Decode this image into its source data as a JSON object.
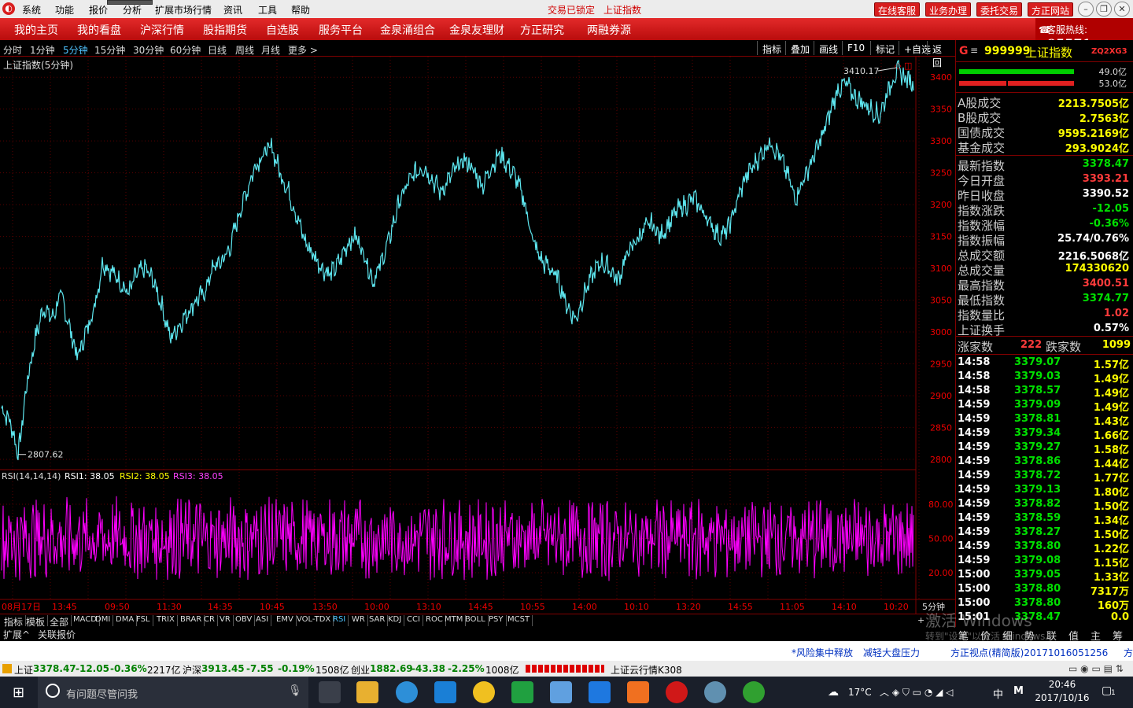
{
  "menu": {
    "items": [
      "系统",
      "功能",
      "报价",
      "分析",
      "扩展市场行情",
      "资讯",
      "工具",
      "帮助"
    ],
    "status_locked": "交易已锁定",
    "status_index": "上证指数",
    "right_buttons": [
      "在线客服",
      "业务办理",
      "委托交易",
      "方正网站"
    ]
  },
  "nav": {
    "items": [
      "我的主页",
      "我的看盘",
      "沪深行情",
      "股指期货",
      "自选股",
      "服务平台",
      "金泉涌组合",
      "金泉友理财",
      "方正研究",
      "两融券源"
    ],
    "hotline_label": "客服热线:",
    "hotline_number": "95571"
  },
  "periods": {
    "items": [
      "分时",
      "1分钟",
      "5分钟",
      "15分钟",
      "30分钟",
      "60分钟",
      "日线",
      "周线",
      "月线",
      "更多 >"
    ],
    "active_index": 2,
    "tools": [
      "指标",
      "叠加",
      "画线",
      "F10",
      "标记",
      "+自选",
      "返回"
    ]
  },
  "chart_data": {
    "type": "line",
    "title": "上证指数(5分钟)",
    "price_axis": [
      3400,
      3350,
      3300,
      3250,
      3200,
      3150,
      3100,
      3050,
      3000,
      2950,
      2900,
      2850,
      2800
    ],
    "ylim": [
      2790,
      3420
    ],
    "high_annotation": "3410.17",
    "low_annotation": "2807.62",
    "x": [
      "08月17日",
      "13:45",
      "09:50",
      "11:30",
      "14:35",
      "10:45",
      "13:50",
      "10:00",
      "13:10",
      "14:45",
      "10:55",
      "14:00",
      "10:10",
      "13:20",
      "14:55",
      "11:05",
      "14:10",
      "10:20"
    ],
    "series": [
      {
        "values": [
          2880,
          2860,
          2808,
          2920,
          2990,
          3040,
          3020,
          3060,
          3010,
          2960,
          3000,
          3040,
          3110,
          3095,
          3080,
          3060,
          3090,
          3100,
          3080,
          3040,
          2990,
          3010,
          3030,
          3050,
          3060,
          3100,
          3110,
          3130,
          3180,
          3220,
          3260,
          3280,
          3290,
          3250,
          3220,
          3180,
          3140,
          3120,
          3100,
          3090,
          3110,
          3140,
          3150,
          3120,
          3080,
          3110,
          3150,
          3200,
          3230,
          3250,
          3260,
          3240,
          3220,
          3240,
          3260,
          3270,
          3250,
          3230,
          3260,
          3280,
          3260,
          3240,
          3200,
          3140,
          3110,
          3100,
          3080,
          3040,
          3020,
          3060,
          3090,
          3110,
          3100,
          3080,
          3120,
          3140,
          3160,
          3170,
          3150,
          3170,
          3190,
          3200,
          3210,
          3190,
          3170,
          3150,
          3160,
          3200,
          3240,
          3260,
          3280,
          3300,
          3280,
          3250,
          3210,
          3240,
          3270,
          3300,
          3340,
          3380,
          3390,
          3370,
          3360,
          3350,
          3340,
          3380,
          3410,
          3400,
          3390
        ]
      }
    ],
    "rsi_title": "RSI(14,14,14)",
    "rsi_labels": [
      "RSI1: 38.05",
      "RSI2: 38.05",
      "RSI3: 38.05"
    ],
    "rsi_axis": [
      "80.00",
      "50.00",
      "20.00"
    ],
    "rsi_ylim": [
      0,
      100
    ]
  },
  "indicators": {
    "left_tabs": [
      "指标",
      "模板",
      "全部"
    ],
    "items": [
      "MACD",
      "DMI",
      "DMA",
      "FSL",
      "TRIX",
      "BRAR",
      "CR",
      "VR",
      "OBV",
      "ASI",
      "EMV",
      "VOL-TDX",
      "RSI",
      "WR",
      "SAR",
      "KDJ",
      "CCI",
      "ROC",
      "MTM",
      "BOLL",
      "PSY",
      "MCST"
    ],
    "active": "RSI",
    "ext": [
      "扩展^",
      "关联报价"
    ],
    "min_period": "5分钟"
  },
  "quote": {
    "code": "999999",
    "name": "上证指数",
    "tag": "ZQ2XG3",
    "bar_up_pct": "49.0亿",
    "bar_dn_pct": "53.0亿",
    "vol_rows": [
      {
        "k": "A股成交",
        "v": "2213.7505亿"
      },
      {
        "k": "B股成交",
        "v": "2.7563亿"
      },
      {
        "k": "国债成交",
        "v": "9595.2169亿"
      },
      {
        "k": "基金成交",
        "v": "293.9024亿"
      }
    ],
    "stat_rows": [
      {
        "k": "最新指数",
        "v": "3378.47",
        "c": "dn"
      },
      {
        "k": "今日开盘",
        "v": "3393.21",
        "c": "up"
      },
      {
        "k": "昨日收盘",
        "v": "3390.52",
        "c": "wt"
      },
      {
        "k": "指数涨跌",
        "v": "-12.05",
        "c": "dn"
      },
      {
        "k": "指数涨幅",
        "v": "-0.36%",
        "c": "dn"
      },
      {
        "k": "指数振幅",
        "v": "25.74/0.76%",
        "c": "wt"
      },
      {
        "k": "总成交额",
        "v": "2216.5068亿",
        "c": "wt"
      },
      {
        "k": "总成交量",
        "v": "174330620",
        "c": "yl"
      },
      {
        "k": "最高指数",
        "v": "3400.51",
        "c": "up"
      },
      {
        "k": "最低指数",
        "v": "3374.77",
        "c": "dn"
      },
      {
        "k": "指数量比",
        "v": "1.02",
        "c": "up"
      },
      {
        "k": "上证换手",
        "v": "0.57%",
        "c": "wt"
      }
    ],
    "adv_label": "涨家数",
    "adv_value": "222",
    "dec_label": "跌家数",
    "dec_value": "1099",
    "ticks": [
      {
        "t": "14:58",
        "p": "3379.07",
        "v": "1.57亿"
      },
      {
        "t": "14:58",
        "p": "3379.03",
        "v": "1.49亿"
      },
      {
        "t": "14:58",
        "p": "3378.57",
        "v": "1.49亿"
      },
      {
        "t": "14:59",
        "p": "3379.09",
        "v": "1.49亿"
      },
      {
        "t": "14:59",
        "p": "3378.81",
        "v": "1.43亿"
      },
      {
        "t": "14:59",
        "p": "3379.34",
        "v": "1.66亿"
      },
      {
        "t": "14:59",
        "p": "3379.27",
        "v": "1.58亿"
      },
      {
        "t": "14:59",
        "p": "3378.86",
        "v": "1.44亿"
      },
      {
        "t": "14:59",
        "p": "3378.72",
        "v": "1.77亿"
      },
      {
        "t": "14:59",
        "p": "3379.13",
        "v": "1.80亿"
      },
      {
        "t": "14:59",
        "p": "3378.82",
        "v": "1.50亿"
      },
      {
        "t": "14:59",
        "p": "3378.59",
        "v": "1.34亿"
      },
      {
        "t": "14:59",
        "p": "3378.27",
        "v": "1.50亿"
      },
      {
        "t": "14:59",
        "p": "3378.80",
        "v": "1.22亿"
      },
      {
        "t": "14:59",
        "p": "3379.08",
        "v": "1.15亿"
      },
      {
        "t": "15:00",
        "p": "3379.05",
        "v": "1.33亿"
      },
      {
        "t": "15:00",
        "p": "3378.80",
        "v": "7317万"
      },
      {
        "t": "15:00",
        "p": "3378.80",
        "v": "160万"
      },
      {
        "t": "15:01",
        "p": "3378.47",
        "v": "0.0"
      }
    ],
    "bottom_tabs": [
      "笔",
      "价",
      "细",
      "势",
      "联",
      "值",
      "主",
      "筹"
    ]
  },
  "news": {
    "items": [
      "*风险集中释放",
      "减轻大盘压力",
      "方正视点(精简版)20171016051256",
      "方"
    ],
    "watermark1": "激活 Windows",
    "watermark2": "转到\"设置\"以激活 Windows。"
  },
  "ticker": {
    "sh_label": "上证",
    "sh_val": "3378.47",
    "sh_chg": "-12.05",
    "sh_pct": "-0.36%",
    "sh_amt": "2217亿",
    "hs_label": "沪深",
    "hs_val": "3913.45",
    "hs_chg": "-7.55",
    "hs_pct": "-0.19%",
    "hs_amt": "1508亿",
    "cy_label": "创业",
    "cy_val": "1882.69",
    "cy_chg": "-43.38",
    "cy_pct": "-2.25%",
    "cy_amt": "1008亿",
    "cloud": "上证云行情K308"
  },
  "taskbar": {
    "search_placeholder": "有问题尽管问我",
    "temp": "17°C",
    "ime": "中",
    "time": "20:46",
    "date": "2017/10/16",
    "notify": "1"
  },
  "colors": {
    "price_line": "#5ee7f0",
    "rsi_line": "#ff00ff",
    "grid": "#5a0000",
    "axis_text": "#e00000"
  }
}
